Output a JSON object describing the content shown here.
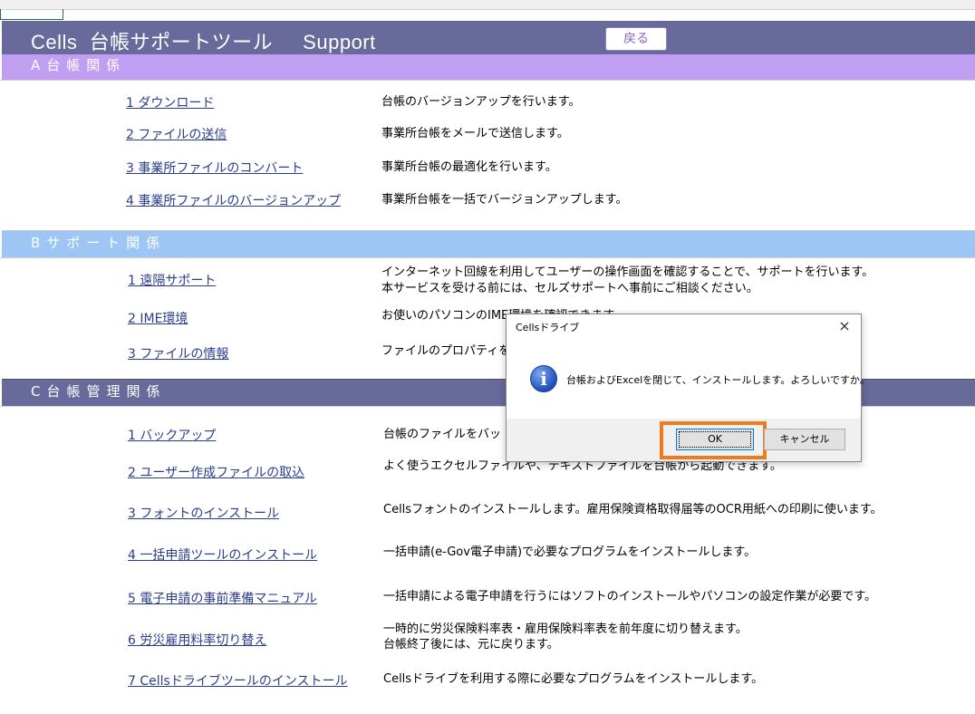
{
  "header": {
    "title": "Cells  台帳サポートツール     Support",
    "back_label": "戻る"
  },
  "sections": {
    "a": {
      "label": "A台帳関係",
      "items": [
        {
          "link": "1  ダウンロード",
          "desc": "台帳のバージョンアップを行います。"
        },
        {
          "link": "2  ファイルの送信",
          "desc": "事業所台帳をメールで送信します。"
        },
        {
          "link": "3  事業所ファイルのコンバート",
          "desc": "事業所台帳の最適化を行います。"
        },
        {
          "link": "4  事業所ファイルのバージョンアップ",
          "desc": "事業所台帳を一括でバージョンアップします。"
        }
      ]
    },
    "b": {
      "label": "Bサポート関係",
      "items": [
        {
          "link": "1  遠隔サポート",
          "desc": "インターネット回線を利用してユーザーの操作画面を確認することで、サポートを行います。",
          "desc2": "本サービスを受ける前には、セルズサポートへ事前にご相談ください。"
        },
        {
          "link": "2  IME環境",
          "desc": "お使いのパソコンのIME環境を確認できます。"
        },
        {
          "link": "3  ファイルの情報",
          "desc": "ファイルのプロパティを"
        }
      ]
    },
    "c": {
      "label": "C台帳管理関係",
      "items": [
        {
          "link": "1  バックアップ",
          "desc": "台帳のファイルをバッ"
        },
        {
          "link": "2  ユーザー作成ファイルの取込",
          "desc": "よく使うエクセルファイルや、テキストファイルを台帳から起動できます。"
        },
        {
          "link": "3  フォントのインストール",
          "desc": "Cellsフォントのインストールします。雇用保険資格取得届等のOCR用紙への印刷に使います。"
        },
        {
          "link": "4  一括申請ツールのインストール",
          "desc": "一括申請(e-Gov電子申請)で必要なプログラムをインストールします。"
        },
        {
          "link": "5  電子申請の事前準備マニュアル",
          "desc": "一括申請による電子申請を行うにはソフトのインストールやパソコンの設定作業が必要です。"
        },
        {
          "link": "6  労災雇用料率切り替え",
          "desc": "一時的に労災保険料率表・雇用保険料率表を前年度に切り替えます。",
          "desc2": "台帳終了後には、元に戻ります。"
        },
        {
          "link": "7  Cellsドライブツールのインストール",
          "desc": "Cellsドライブを利用する際に必要なプログラムをインストールします。"
        }
      ]
    }
  },
  "dialog": {
    "title": "Cellsドライブ",
    "close": "×",
    "icon": "info-icon",
    "message": "台帳およびExcelを閉じて、インストールします。よろしいですか。",
    "ok_label": "OK",
    "cancel_label": "キャンセル"
  },
  "colors": {
    "title_bar": "#676a9a",
    "section_a": "#c09ef2",
    "section_b": "#9ec6f4",
    "section_c": "#676a9a",
    "link": "#2a3e8c",
    "highlight": "#f07a1e"
  }
}
